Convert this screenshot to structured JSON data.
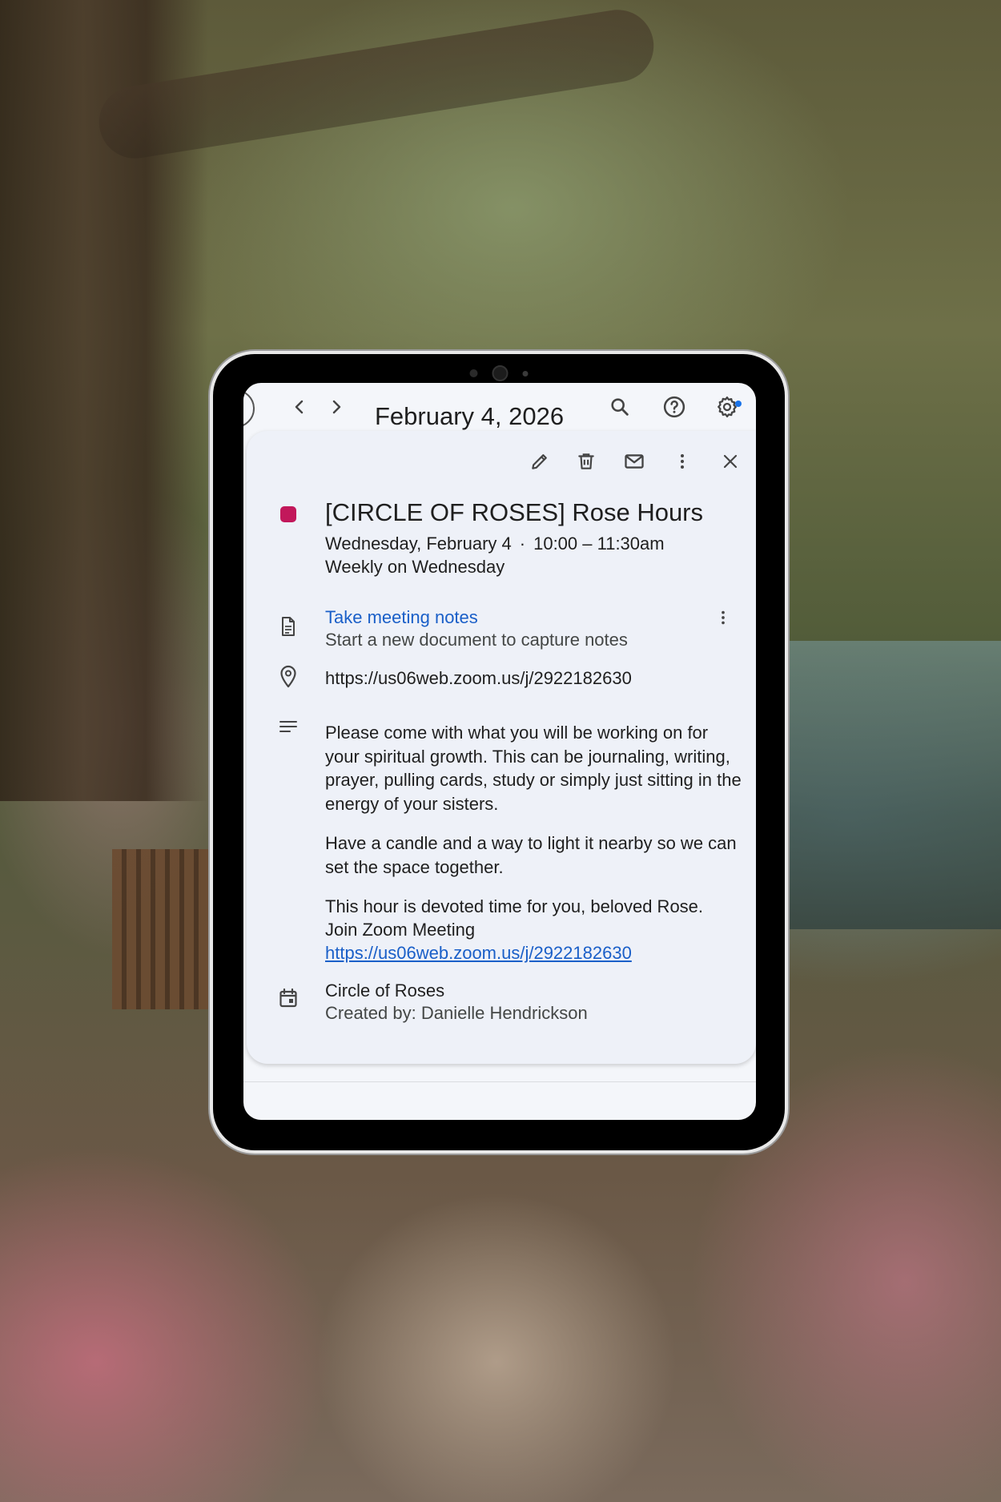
{
  "topbar": {
    "date": "February 4, 2026",
    "icons": [
      "chevron-left-icon",
      "chevron-right-icon",
      "search-icon",
      "help-icon",
      "settings-icon"
    ]
  },
  "event": {
    "color": "#c2185b",
    "title": "[CIRCLE OF ROSES] Rose Hours",
    "date": "Wednesday, February 4",
    "separator": "·",
    "time": "10:00 – 11:30am",
    "recurrence": "Weekly on Wednesday",
    "notes_link": "Take meeting notes",
    "notes_sub": "Start a new document to capture notes",
    "location": "https://us06web.zoom.us/j/2922182630",
    "description": [
      "Please come with what you will be working on for your spiritual growth. This can be journaling, writing, prayer, pulling cards, study or simply just sitting in the energy of your sisters.",
      "Have a candle and a way to light it nearby so we can set the space together.",
      "This hour is devoted time for you, beloved Rose."
    ],
    "zoom_label": "Join Zoom Meeting",
    "zoom_link": "https://us06web.zoom.us/j/2922182630",
    "calendar_name": "Circle of Roses",
    "created_by": "Created by: Danielle Hendrickson"
  },
  "colors": {
    "link": "#1a5fc8",
    "accent_dot": "#1a73e8"
  }
}
